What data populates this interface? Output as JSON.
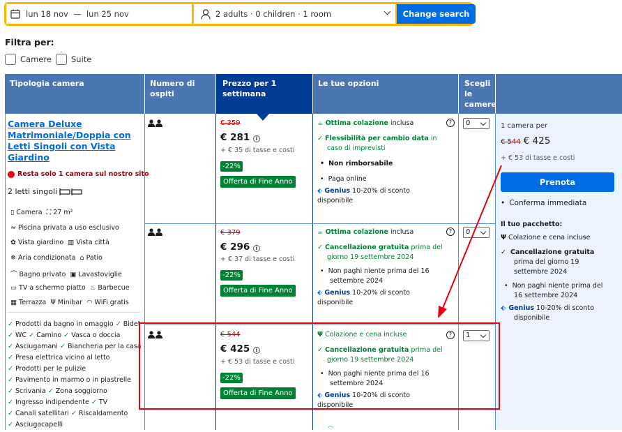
{
  "search": {
    "dates": "lun 18 nov  —  lun 25 nov",
    "guests": "2 adults · 0 children · 1 room",
    "button": "Change search"
  },
  "filter": {
    "title": "Filtra per:",
    "options": [
      "Camere",
      "Suite"
    ]
  },
  "table_headers": [
    "Tipologia camera",
    "Numero di ospiti",
    "Prezzo per 1 settimana",
    "Le tue opzioni",
    "Scegli le camere"
  ],
  "room": {
    "name": "Camera Deluxe Matrimoniale/Doppia con Letti Singoli con Vista Giardino",
    "name_lines": [
      "Camera Deluxe",
      "Matrimoniale/Doppia con",
      "Letti Singoli con Vista",
      "Giardino"
    ],
    "alert": "Resta solo 1 camera sul nostro sito",
    "beds": "2 letti singoli",
    "facilities": [
      [
        "Camera",
        "27 m²"
      ],
      [
        "Piscina privata a uso esclusivo"
      ],
      [
        "Vista giardino",
        "Vista città"
      ],
      [
        "Aria condizionata",
        "Patio"
      ],
      [
        "Bagno privato",
        "Lavastoviglie"
      ],
      [
        "TV a schermo piatto",
        "Barbecue"
      ],
      [
        "Terrazza",
        "Minibar",
        "WiFi gratis"
      ]
    ],
    "amenities": [
      [
        "Prodotti da bagno in omaggio",
        "Bidet"
      ],
      [
        "WC",
        "Camino",
        "Vasca o doccia"
      ],
      [
        "Asciugamani",
        "Biancheria per la casa"
      ],
      [
        "Presa elettrica vicino al letto"
      ],
      [
        "Prodotti per le pulizie"
      ],
      [
        "Pavimento in marmo o in piastrelle"
      ],
      [
        "Scrivania",
        "Zona soggiorno"
      ],
      [
        "Ingresso indipendente",
        "TV"
      ],
      [
        "Canali satellitari",
        "Riscaldamento"
      ],
      [
        "Asciugacapelli"
      ]
    ]
  },
  "rows": [
    {
      "old": "€ 359",
      "price": "€ 281",
      "taxes": "+ € 35 di tasse e costi",
      "discount": "-22%",
      "deal": "Offerta di Fine Anno",
      "o1": "Ottima colazione",
      "o1b": " inclusa",
      "o2": "Flessibilità per cambio data",
      "o2b": " in caso di imprevisti",
      "o3": "Non rimborsabile",
      "o4": "Paga online",
      "genius": "Genius",
      "genius_text": " 10-20% di sconto disponibile",
      "qty": "0"
    },
    {
      "old": "€ 379",
      "price": "€ 296",
      "taxes": "+ € 37 di tasse e costi",
      "discount": "-22%",
      "deal": "Offerta di Fine Anno",
      "o1": "Ottima colazione",
      "o1b": " inclusa",
      "o2": "Cancellazione gratuita",
      "o2b": " prima del giorno 19 settembre 2024",
      "o3": "Non paghi niente prima del 16 settembre 2024",
      "genius": "Genius",
      "genius_text": " 10-20% di sconto disponibile",
      "qty": "0"
    },
    {
      "old": "€ 544",
      "price": "€ 425",
      "taxes": "+ € 53 di tasse e costi",
      "discount": "-22%",
      "deal": "Offerta di Fine Anno",
      "o1": "Colazione e cena incluse",
      "o2": "Cancellazione gratuita",
      "o2b": " prima del giorno 19 settembre 2024",
      "o3": "Non paghi niente prima del 16 settembre 2024",
      "genius": "Genius",
      "genius_text": " 10-20% di sconto disponibile",
      "qty": "1"
    }
  ],
  "summary": {
    "count": "1 camera per",
    "old": "€ 544",
    "price": "€ 425",
    "taxes": "+ € 53 di tasse e costi",
    "button": "Prenota",
    "confirm": "Conferma immediata",
    "package_title": "Il tuo pacchetto:",
    "p1": "Colazione e cena incluse",
    "p2": "Cancellazione gratuita",
    "p2b": " prima del giorno 19 settembre 2024",
    "p3": "Non paghi niente prima del 16 settembre 2024",
    "genius": "Genius",
    "genius_text": " 10-20% di sconto disponibile"
  },
  "colors": {
    "brand": "#006ce4",
    "header": "#4c76b2",
    "header_active": "#003b95",
    "green": "#008234",
    "annotation": "#e8000f",
    "search_border": "#ffb700"
  }
}
